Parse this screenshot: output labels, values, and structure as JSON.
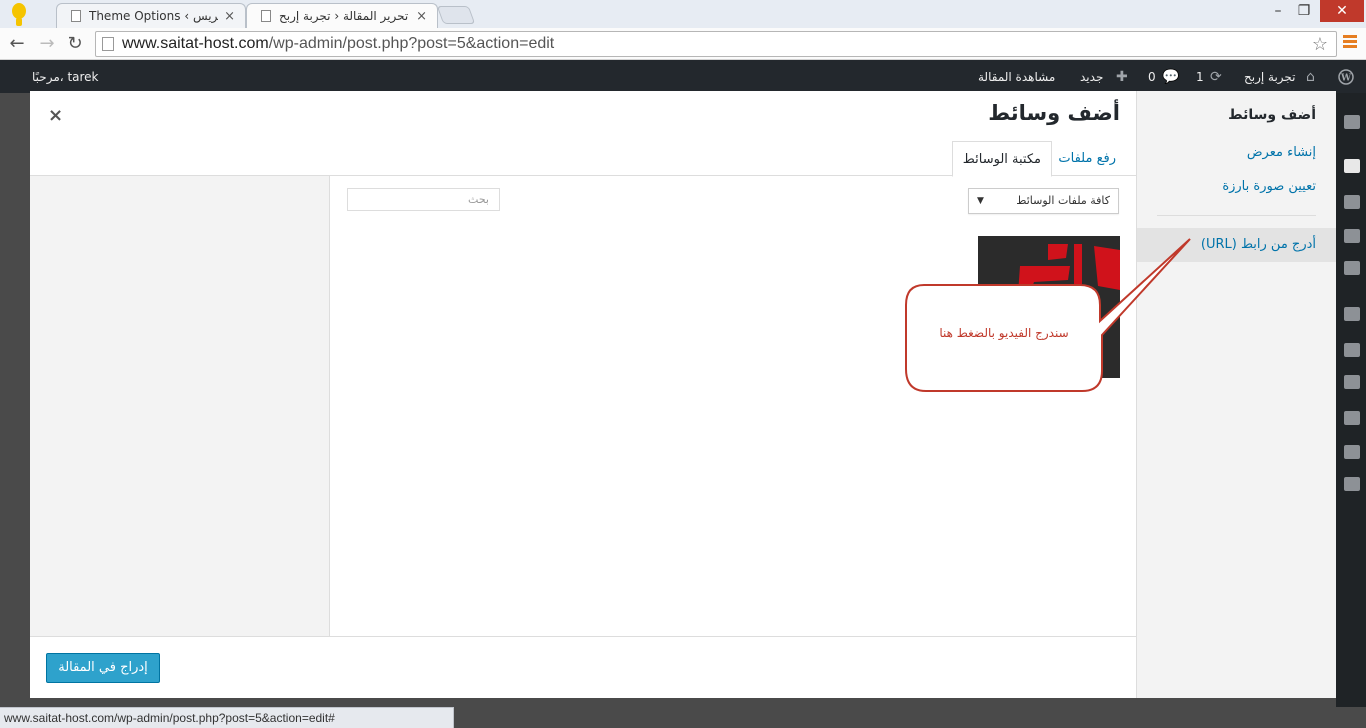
{
  "browser": {
    "tabs": [
      {
        "title": "Theme Options ‹ ووردبريس",
        "close": "×"
      },
      {
        "title": "تحرير المقالة ‹ تجربة إربح —",
        "close": "×"
      }
    ],
    "url_host": "www.saitat-host.com",
    "url_path": "/wp-admin/post.php?post=5&action=edit",
    "status_url": "www.saitat-host.com/wp-admin/post.php?post=5&action=edit#"
  },
  "adminbar": {
    "greeting": "مرحبًا، tarek",
    "site_name": "تجربة إربح",
    "updates_count": "1",
    "comments_count": "0",
    "new_label": "جديد",
    "view_post": "مشاهدة المقالة"
  },
  "media_menu": {
    "title": "أضف وسائط",
    "items": [
      "إنشاء معرض",
      "تعيين صورة بارزة",
      "أدرج من رابط (URL)"
    ]
  },
  "frame": {
    "title": "أضف وسائط",
    "tabs": [
      "رفع ملفات",
      "مكتبة الوسائط"
    ],
    "close": "×"
  },
  "browser_toolbar": {
    "filter_label": "كافة ملفات الوسائط",
    "search_placeholder": "بحث"
  },
  "footer": {
    "insert_button": "إدراج في المقالة"
  },
  "annotation": {
    "text": "سندرج الفيديو بالضغط هنا"
  },
  "colors": {
    "link": "#0073aa",
    "button": "#2ea2cc",
    "adminbar": "#23282d",
    "callout_border": "#c0392b"
  }
}
